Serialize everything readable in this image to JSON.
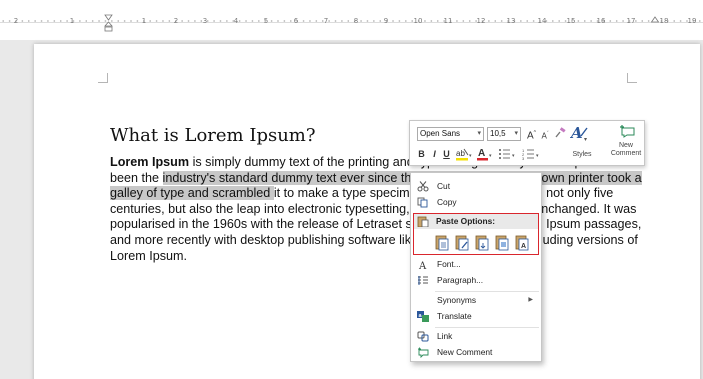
{
  "ruler": {
    "ticks": [
      "2",
      "1",
      "1",
      "2",
      "3",
      "4",
      "5",
      "6",
      "7",
      "8",
      "9",
      "10",
      "11",
      "12",
      "13",
      "14",
      "15",
      "16",
      "17",
      "18",
      "19"
    ]
  },
  "document": {
    "title": "What is Lorem Ipsum?",
    "paragraph": {
      "bold_lead": "Lorem Ipsum",
      "seg1": " is simply dummy text of the printing and typesetting industry. Lorem Ipsum has been the ",
      "highlighted": "industry's standard dummy text ever since the 1500s, when an unknown printer took a galley of type and scrambled ",
      "seg2": "it to make a type specimen book. It has survived not only five centuries, but also the leap into electronic typesetting, remaining essentially unchanged. It was popularised in the 1960s with the release of Letraset sheets containing Lorem Ipsum passages, and more recently with desktop publishing software like Aldus PageMaker including versions of Lorem Ipsum."
    }
  },
  "mini_toolbar": {
    "font_name": "Open Sans",
    "font_size": "10,5",
    "grow_font": "A",
    "shrink_font": "A",
    "bold": "B",
    "italic": "I",
    "underline": "U",
    "font_color_letter": "A",
    "styles_label": "Styles",
    "new_comment_label": "New Comment",
    "accent_color": "#2b579a",
    "highlight_color": "#f5e000",
    "font_color": "#d9262d"
  },
  "context_menu": {
    "cut": "Cut",
    "copy": "Copy",
    "paste_options": "Paste Options:",
    "font": "Font...",
    "paragraph": "Paragraph...",
    "synonyms": "Synonyms",
    "translate": "Translate",
    "link": "Link",
    "new_comment": "New Comment",
    "highlight_border_color": "#d9262d"
  }
}
